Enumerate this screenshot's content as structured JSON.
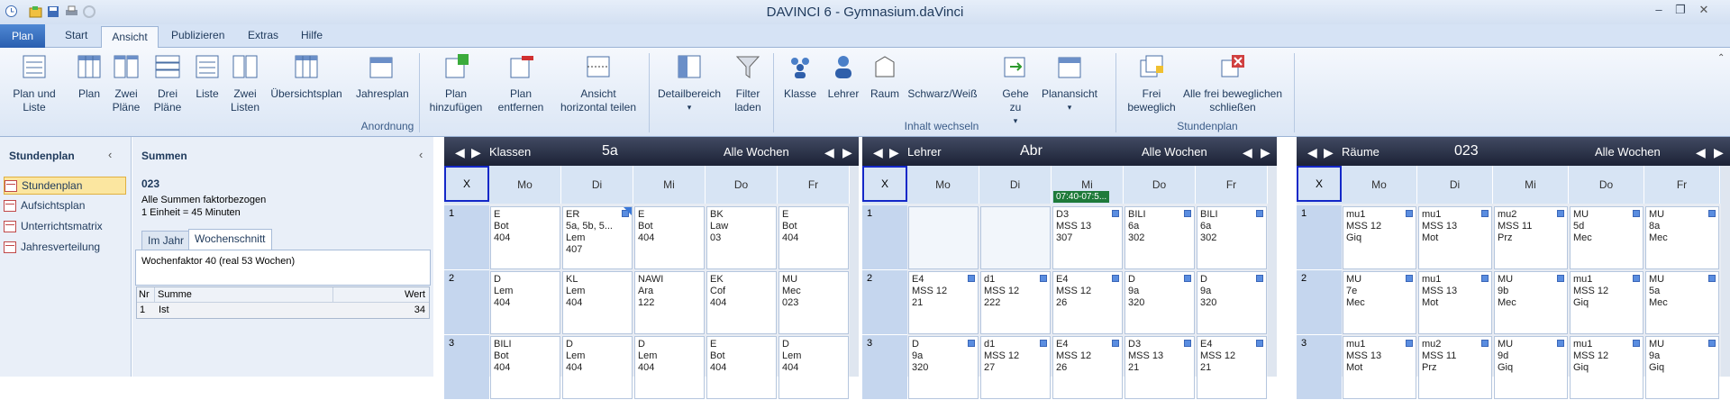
{
  "window": {
    "title": "DAVINCI 6 - Gymnasium.daVinci"
  },
  "ribbon_tabs": [
    "Plan",
    "Start",
    "Ansicht",
    "Publizieren",
    "Extras",
    "Hilfe"
  ],
  "ribbon": {
    "buttons": [
      {
        "label": "Plan und\nListe"
      },
      {
        "label": "Plan"
      },
      {
        "label": "Zwei\nPläne"
      },
      {
        "label": "Drei\nPläne"
      },
      {
        "label": "Liste"
      },
      {
        "label": "Zwei\nListen"
      },
      {
        "label": "Übersichtsplan"
      },
      {
        "label": "Jahresplan"
      },
      {
        "label": "Plan\nhinzufügen"
      },
      {
        "label": "Plan\nentfernen"
      },
      {
        "label": "Ansicht\nhorizontal teilen"
      },
      {
        "label": "Detailbereich"
      },
      {
        "label": "Filter\nladen"
      },
      {
        "label": "Klasse"
      },
      {
        "label": "Lehrer"
      },
      {
        "label": "Raum"
      },
      {
        "label": "Schwarz/Weiß"
      },
      {
        "label": "Gehe\nzu"
      },
      {
        "label": "Planansicht"
      },
      {
        "label": "Frei\nbeweglich"
      },
      {
        "label": "Alle frei beweglichen\nschließen"
      }
    ],
    "groups": {
      "anordnung": "Anordnung",
      "inhalt": "Inhalt wechseln",
      "stundenplan": "Stundenplan"
    }
  },
  "left_panel": {
    "title": "Stundenplan",
    "items": [
      "Stundenplan",
      "Aufsichtsplan",
      "Unterrichtsmatrix",
      "Jahresverteilung"
    ]
  },
  "summen": {
    "title": "Summen",
    "number": "023",
    "line1": "Alle Summen faktorbezogen",
    "line2": "1 Einheit = 45 Minuten",
    "tabs": [
      "Im Jahr",
      "Wochenschnitt"
    ],
    "wochenfaktor": "Wochenfaktor 40 (real 53 Wochen)",
    "columns": [
      "Nr",
      "Summe",
      "Wert"
    ],
    "rows": [
      {
        "nr": "1",
        "summe": "Ist",
        "wert": "34"
      }
    ]
  },
  "panels": [
    {
      "type": "Klassen",
      "entity": "5a",
      "weeks": "Alle Wochen",
      "days": [
        "X",
        "Mo",
        "Di",
        "Mi",
        "Do",
        "Fr"
      ],
      "periods": [
        "1",
        "2",
        "3"
      ],
      "cells": [
        [
          "E\nBot\n404",
          "ER\n5a, 5b, 5...\nLem\n407",
          "E\nBot\n404",
          "BK\nLaw\n03",
          "E\nBot\n404"
        ],
        [
          "D\nLem\n404",
          "KL\nLem\n404",
          "NAWI\nAra\n122",
          "EK\nCof\n404",
          "MU\nMec\n023"
        ],
        [
          "BILI\nBot\n404",
          "D\nLem\n404",
          "D\nLem\n404",
          "E\nBot\n404",
          "D\nLem\n404"
        ]
      ]
    },
    {
      "type": "Lehrer",
      "entity": "Abr",
      "weeks": "Alle Wochen",
      "days": [
        "X",
        "Mo",
        "Di",
        "Mi",
        "Do",
        "Fr"
      ],
      "periods": [
        "1",
        "2",
        "3"
      ],
      "time_badge": "07:40-07:5...",
      "cells": [
        [
          "",
          "",
          "D3\nMSS 13\n307",
          "BILI\n6a\n302",
          "BILI\n6a\n302"
        ],
        [
          "E4\nMSS 12\n21",
          "d1\nMSS 12\n222",
          "E4\nMSS 12\n26",
          "D\n9a\n320",
          "D\n9a\n320"
        ],
        [
          "D\n9a\n320",
          "d1\nMSS 12\n27",
          "E4\nMSS 12\n26",
          "D3\nMSS 13\n21",
          "E4\nMSS 12\n21"
        ]
      ]
    },
    {
      "type": "Räume",
      "entity": "023",
      "weeks": "Alle Wochen",
      "days": [
        "X",
        "Mo",
        "Di",
        "Mi",
        "Do",
        "Fr"
      ],
      "periods": [
        "1",
        "2",
        "3"
      ],
      "cells": [
        [
          "mu1\nMSS 12\nGiq",
          "mu1\nMSS 13\nMot",
          "mu2\nMSS 11\nPrz",
          "MU\n5d\nMec",
          "MU\n8a\nMec"
        ],
        [
          "MU\n7e\nMec",
          "mu1\nMSS 13\nMot",
          "MU\n9b\nMec",
          "mu1\nMSS 12\nGiq",
          "MU\n5a\nMec"
        ],
        [
          "mu1\nMSS 13\nMot",
          "mu2\nMSS 11\nPrz",
          "MU\n9d\nGiq",
          "mu1\nMSS 12\nGiq",
          "MU\n9a\nGiq"
        ]
      ]
    }
  ]
}
